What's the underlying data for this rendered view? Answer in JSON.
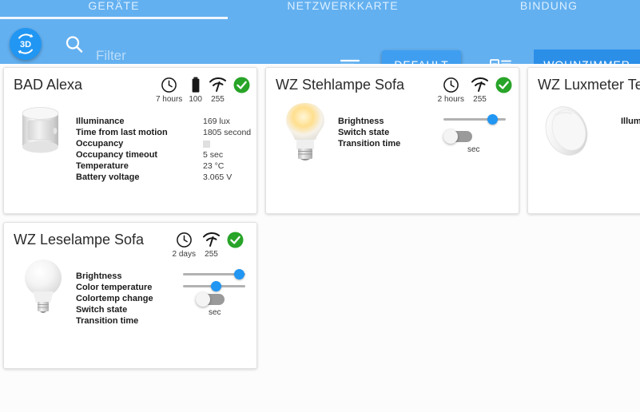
{
  "tabs": [
    {
      "label": "GERÄTE",
      "active": true
    },
    {
      "label": "NETZWERKKARTE",
      "active": false
    },
    {
      "label": "BINDUNG",
      "active": false
    }
  ],
  "toolbar": {
    "logo_text": "3D",
    "logo_icon": "3d-rotate-icon",
    "search_icon": "search-icon",
    "filter_value": "",
    "filter_placeholder": "Filter",
    "sort_icon": "sort-descending-icon",
    "default_button": "DEFAULT",
    "layout_icon": "list-layout-icon",
    "room_button": "WOHNZIMMER"
  },
  "colors": {
    "toolbar_blue": "#63b0f0",
    "accent_blue": "#2196f3",
    "room_button_blue": "#2b8fe8",
    "status_ok_green": "#28a428",
    "page_background": "#fcfcfc"
  },
  "cards": [
    {
      "title": "BAD Alexa",
      "device_icon": "motion-sensor-icon",
      "status": [
        {
          "icon": "clock-icon",
          "label": "7 hours"
        },
        {
          "icon": "battery-icon",
          "label": "100"
        },
        {
          "icon": "signal-icon",
          "label": "255"
        },
        {
          "icon": "check-circle-icon",
          "label": ""
        }
      ],
      "attributes": [
        {
          "label": "Illuminance",
          "value": "169 lux"
        },
        {
          "label": "Time from last motion",
          "value": "1805 second"
        },
        {
          "label": "Occupancy",
          "value": "",
          "control": "checkbox"
        },
        {
          "label": "Occupancy timeout",
          "value": "5 sec"
        },
        {
          "label": "Temperature",
          "value": "23 °C"
        },
        {
          "label": "Battery voltage",
          "value": "3.065 V"
        }
      ]
    },
    {
      "title": "WZ Stehlampe Sofa",
      "device_icon": "light-bulb-on-icon",
      "status": [
        {
          "icon": "clock-icon",
          "label": "2 hours"
        },
        {
          "icon": "signal-icon",
          "label": "255"
        },
        {
          "icon": "check-circle-icon",
          "label": ""
        }
      ],
      "attributes": [
        {
          "label": "Brightness",
          "control": "slider",
          "slider_percent": 76
        },
        {
          "label": "Switch state",
          "control": "toggle",
          "toggle_on": false
        },
        {
          "label": "Transition time",
          "control": "unit",
          "unit": "sec"
        }
      ]
    },
    {
      "title": "WZ Luxmeter Ter",
      "device_icon": "lux-sensor-icon",
      "status": [],
      "attributes": [
        {
          "label": "Illuminan",
          "value": ""
        }
      ]
    },
    {
      "title": "WZ Leselampe Sofa",
      "device_icon": "light-bulb-off-icon",
      "status": [
        {
          "icon": "clock-icon",
          "label": "2 days"
        },
        {
          "icon": "signal-icon",
          "label": "255"
        },
        {
          "icon": "check-circle-icon",
          "label": ""
        }
      ],
      "attributes": [
        {
          "label": "Brightness",
          "control": "slider",
          "slider_percent": 88
        },
        {
          "label": "Color temperature",
          "control": "slider",
          "slider_percent": 48
        },
        {
          "label": "Colortemp change",
          "control": "none"
        },
        {
          "label": "Switch state",
          "control": "toggle",
          "toggle_on": false
        },
        {
          "label": "Transition time",
          "control": "unit",
          "unit": "sec"
        }
      ]
    }
  ]
}
